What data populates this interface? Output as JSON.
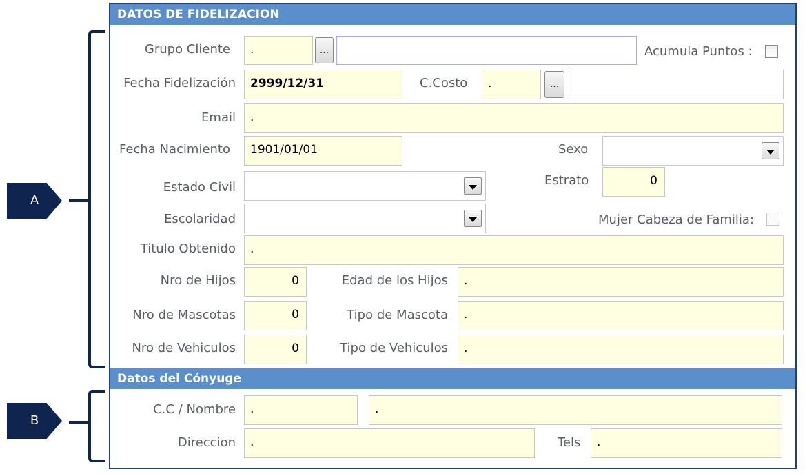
{
  "markers": {
    "a": "A",
    "b": "B"
  },
  "loyalty": {
    "header": "DATOS DE FIDELIZACION",
    "grupo_cliente": {
      "label": "Grupo Cliente",
      "code": ".",
      "button": "...",
      "description": ""
    },
    "acumula_puntos": {
      "label": "Acumula Puntos :",
      "checked": false
    },
    "fecha_fidelizacion": {
      "label": "Fecha Fidelización",
      "value": "2999/12/31"
    },
    "c_costo": {
      "label": "C.Costo",
      "code": ".",
      "button": "...",
      "description": ""
    },
    "email": {
      "label": "Email",
      "value": "."
    },
    "fecha_nacimiento": {
      "label": "Fecha Nacimiento",
      "value": "1901/01/01"
    },
    "sexo": {
      "label": "Sexo",
      "value": ""
    },
    "estado_civil": {
      "label": "Estado Civil",
      "value": ""
    },
    "estrato": {
      "label": "Estrato",
      "value": "0"
    },
    "escolaridad": {
      "label": "Escolaridad",
      "value": ""
    },
    "mujer_cabeza": {
      "label": "Mujer Cabeza de Familia:",
      "checked": false
    },
    "titulo": {
      "label": "Titulo Obtenido",
      "value": "."
    },
    "nro_hijos": {
      "label": "Nro de Hijos",
      "value": "0"
    },
    "edad_hijos": {
      "label": "Edad de los Hijos",
      "value": "."
    },
    "nro_mascotas": {
      "label": "Nro de Mascotas",
      "value": "0"
    },
    "tipo_mascota": {
      "label": "Tipo de Mascota",
      "value": "."
    },
    "nro_vehiculos": {
      "label": "Nro de Vehiculos",
      "value": "0"
    },
    "tipo_vehiculos": {
      "label": "Tipo de Vehiculos",
      "value": "."
    }
  },
  "spouse": {
    "header": "Datos del Cónyuge",
    "cc_nombre": {
      "label": "C.C / Nombre",
      "cc": ".",
      "nombre": "."
    },
    "direccion": {
      "label": "Direccion",
      "value": "."
    },
    "tels": {
      "label": "Tels",
      "value": "."
    }
  }
}
